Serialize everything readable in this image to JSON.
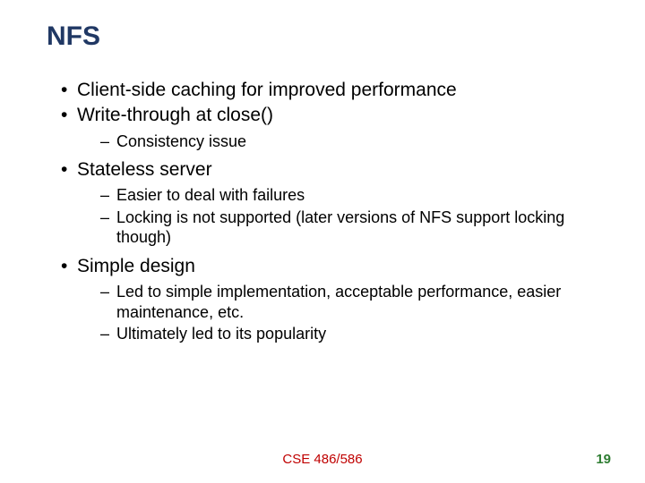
{
  "title": "NFS",
  "bullets": [
    {
      "text": "Client-side caching for improved performance",
      "sub": []
    },
    {
      "text": "Write-through at close()",
      "sub": [
        "Consistency issue"
      ]
    },
    {
      "text": "Stateless server",
      "sub": [
        "Easier to deal with failures",
        "Locking is not supported (later versions of NFS support locking though)"
      ]
    },
    {
      "text": "Simple design",
      "sub": [
        "Led to simple implementation, acceptable performance, easier maintenance, etc.",
        "Ultimately led to its popularity"
      ]
    }
  ],
  "footer": {
    "center": "CSE 486/586",
    "page": "19"
  }
}
